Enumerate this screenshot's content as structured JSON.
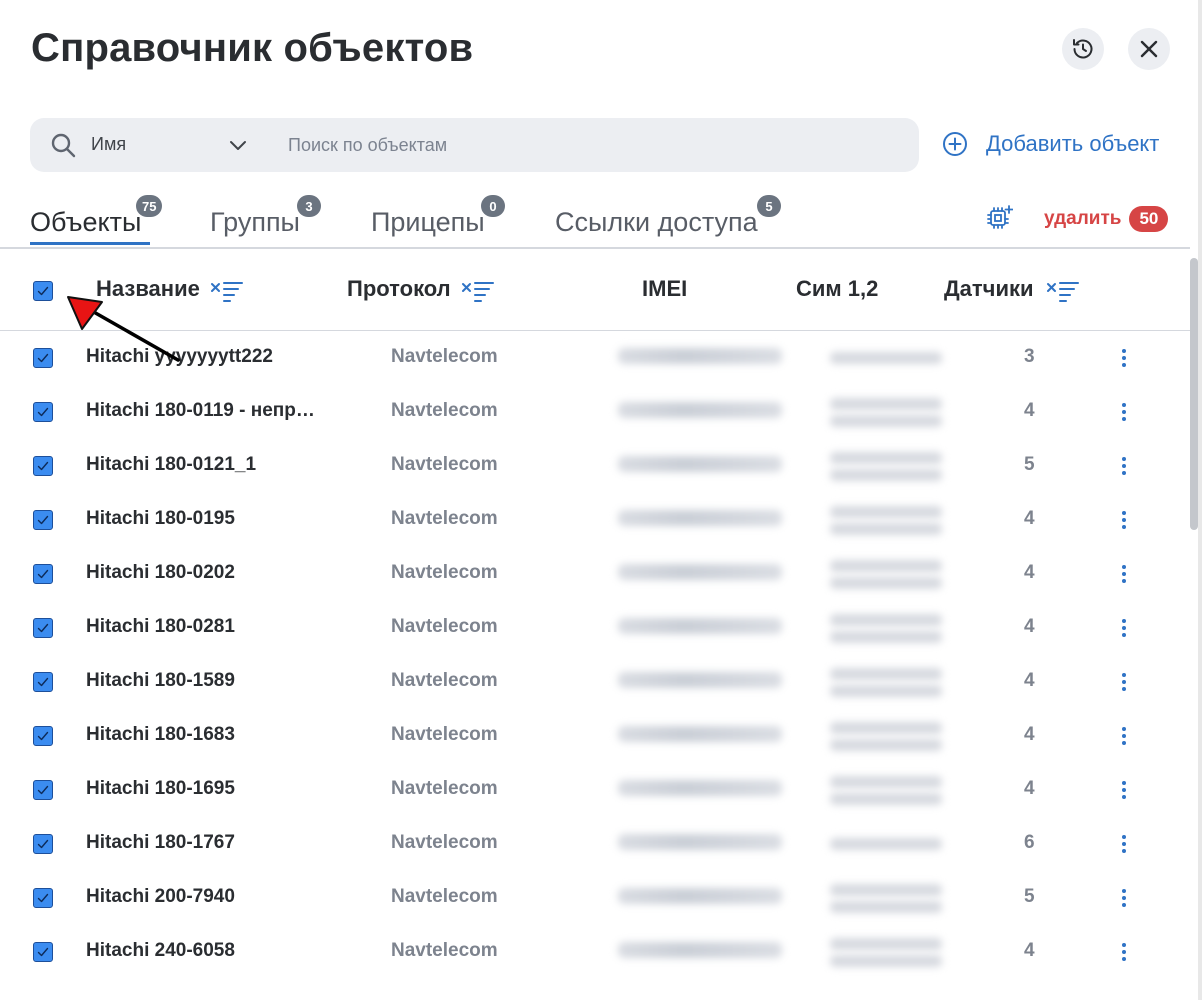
{
  "header": {
    "title": "Справочник объектов",
    "history_icon": "history-icon",
    "close_icon": "close-icon"
  },
  "search": {
    "type_value": "Имя",
    "placeholder": "Поиск по объектам",
    "value": ""
  },
  "add_object": {
    "label": "Добавить объект",
    "icon": "plus-circle-icon"
  },
  "tabs": [
    {
      "label": "Объекты",
      "count": "75",
      "active": true
    },
    {
      "label": "Группы",
      "count": "3",
      "active": false
    },
    {
      "label": "Прицепы",
      "count": "0",
      "active": false
    },
    {
      "label": "Ссылки доступа",
      "count": "5",
      "active": false
    }
  ],
  "actions": {
    "delete_label": "удалить",
    "delete_count": "50"
  },
  "table": {
    "columns": [
      "Название",
      "Протокол",
      "IMEI",
      "Сим 1,2",
      "Датчики"
    ],
    "rows": [
      {
        "name": "Hitachi yyyyyyytt222",
        "protocol": "Navtelecom",
        "sensors": "3"
      },
      {
        "name": "Hitachi 180-0119 - непр…",
        "protocol": "Navtelecom",
        "sensors": "4"
      },
      {
        "name": "Hitachi 180-0121_1",
        "protocol": "Navtelecom",
        "sensors": "5"
      },
      {
        "name": "Hitachi 180-0195",
        "protocol": "Navtelecom",
        "sensors": "4"
      },
      {
        "name": "Hitachi 180-0202",
        "protocol": "Navtelecom",
        "sensors": "4"
      },
      {
        "name": "Hitachi 180-0281",
        "protocol": "Navtelecom",
        "sensors": "4"
      },
      {
        "name": "Hitachi 180-1589",
        "protocol": "Navtelecom",
        "sensors": "4"
      },
      {
        "name": "Hitachi 180-1683",
        "protocol": "Navtelecom",
        "sensors": "4"
      },
      {
        "name": "Hitachi 180-1695",
        "protocol": "Navtelecom",
        "sensors": "4"
      },
      {
        "name": "Hitachi 180-1767",
        "protocol": "Navtelecom",
        "sensors": "6"
      },
      {
        "name": "Hitachi 200-7940",
        "protocol": "Navtelecom",
        "sensors": "5"
      },
      {
        "name": "Hitachi 240-6058",
        "protocol": "Navtelecom",
        "sensors": "4"
      }
    ]
  },
  "colors": {
    "accent": "#2f73c5",
    "checkbox": "#3b8cf0",
    "danger": "#d64545",
    "annotation_arrow": "#e81414"
  }
}
